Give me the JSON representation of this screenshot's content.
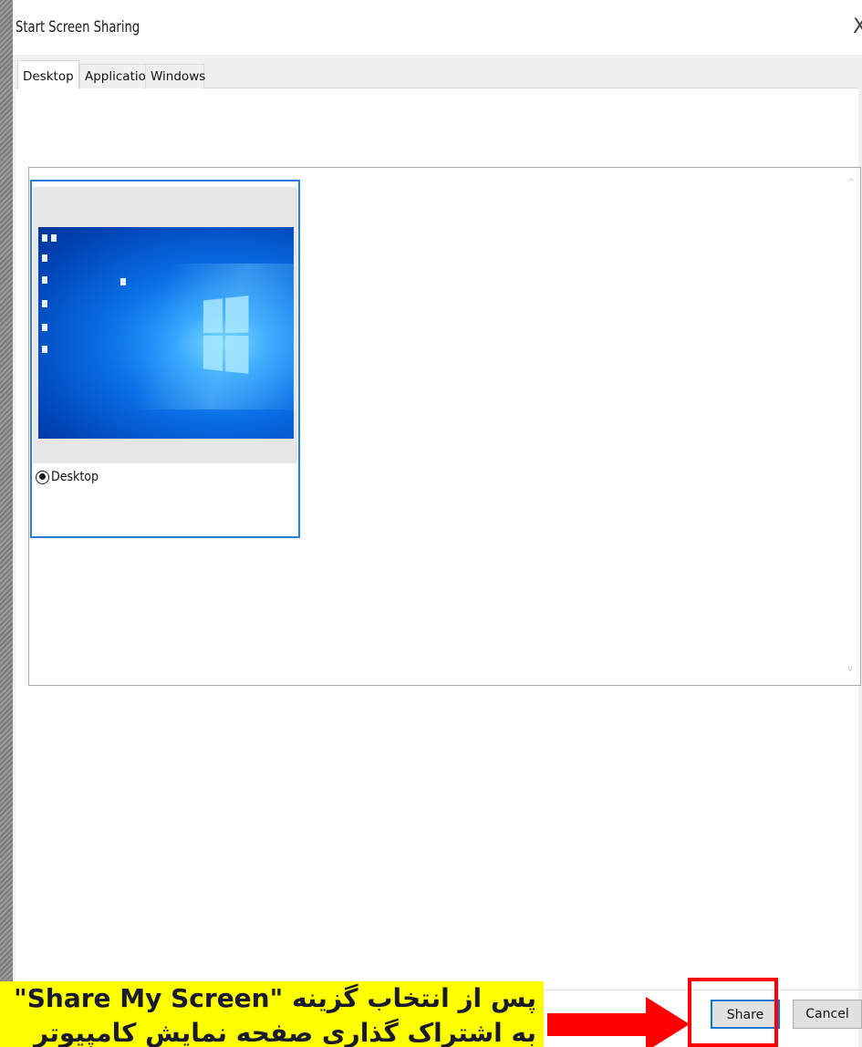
{
  "dialog": {
    "title": "Start Screen Sharing",
    "close_glyph": "X"
  },
  "tabs": [
    {
      "label": "Desktop",
      "active": true
    },
    {
      "label": "Applications",
      "active": false
    },
    {
      "label": "Windows",
      "active": false
    }
  ],
  "items": [
    {
      "label": "Desktop",
      "selected": true
    }
  ],
  "scroll": {
    "up_glyph": "^",
    "down_glyph": "v"
  },
  "buttons": {
    "share_label": "Share",
    "cancel_label": "Cancel"
  },
  "annotation": {
    "line1": "پس از انتخاب گزینه \"Share My Screen\"",
    "line2": "به اشتراک گذاری صفحه نمایش کامپیوتر",
    "highlight_color": "#ff0000",
    "note_background": "#ffff00"
  }
}
